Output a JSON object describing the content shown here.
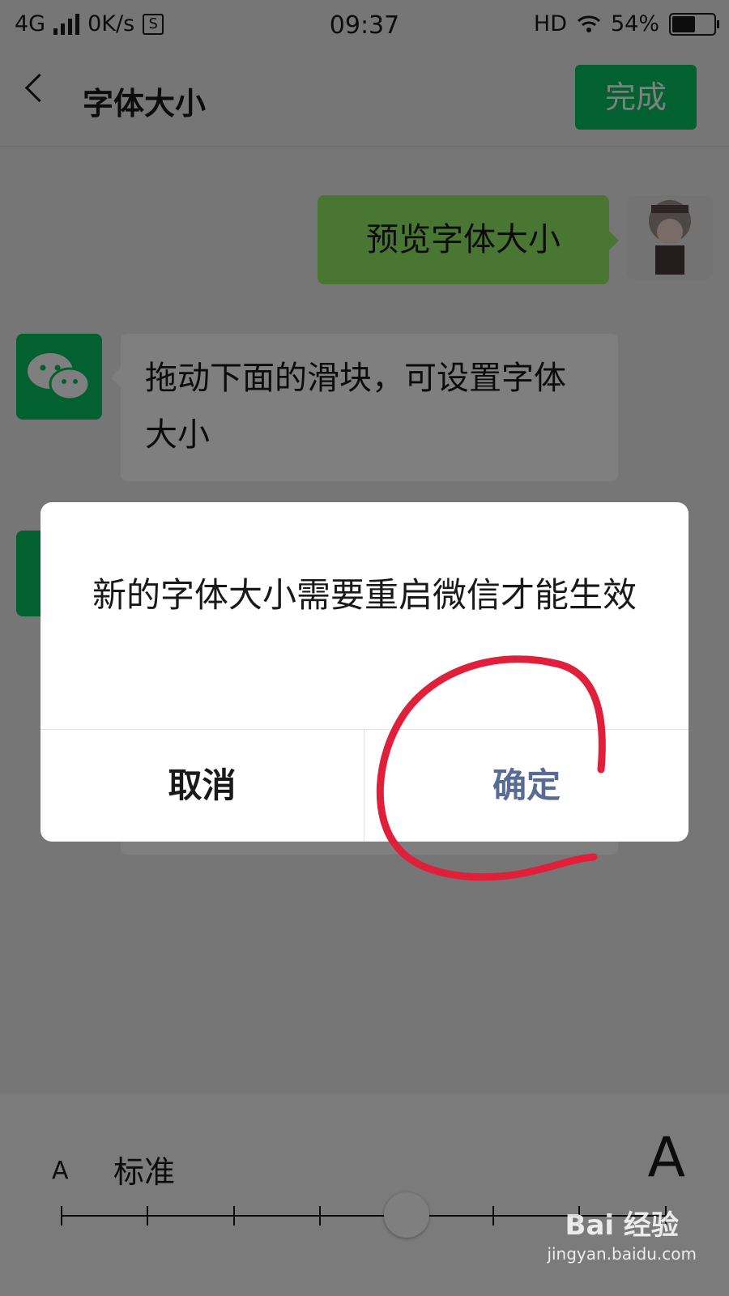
{
  "status_bar": {
    "network": "4G",
    "speed": "0K/s",
    "sim_icon": "S",
    "time": "09:37",
    "hd": "HD",
    "battery": "54%"
  },
  "nav": {
    "title": "字体大小",
    "done_label": "完成"
  },
  "chat": {
    "preview_message": "预览字体大小",
    "instruction_message": "拖动下面的滑块，可设置字体大小"
  },
  "font_slider": {
    "small_label": "A",
    "large_label": "A",
    "current_label": "标准",
    "levels": 8,
    "current_level": 4
  },
  "dialog": {
    "message": "新的字体大小需要重启微信才能生效",
    "cancel_label": "取消",
    "confirm_label": "确定"
  },
  "watermark": {
    "brand": "Bai 经验",
    "url": "jingyan.baidu.com"
  },
  "colors": {
    "accent_green": "#07c160",
    "bubble_green": "#95ec69",
    "link_blue": "#576b95",
    "annotation_red": "#e0203a"
  }
}
